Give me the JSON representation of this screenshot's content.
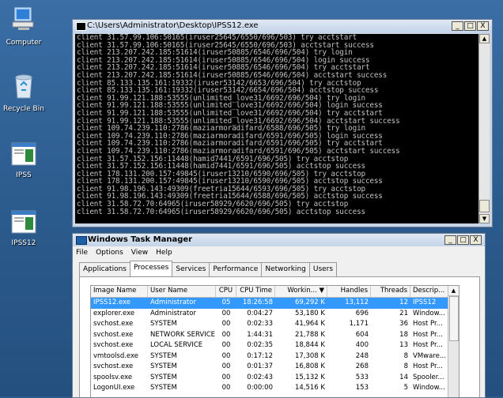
{
  "desktop": {
    "icons": [
      {
        "label": "Computer",
        "icon": "computer-icon"
      },
      {
        "label": "Recycle Bin",
        "icon": "recycle-bin-icon"
      },
      {
        "label": "IPSS",
        "icon": "program-icon"
      },
      {
        "label": "IPSS12",
        "icon": "program-icon"
      }
    ]
  },
  "cmd_window": {
    "title": "C:\\Users\\Administrator\\Desktop\\IPSS12.exe",
    "buttons": {
      "minimize": "_",
      "maximize": "□",
      "close": "X"
    },
    "lines": [
      "client 31.57.99.106:50165(iruser25645/6550/696/503) try acctstart",
      "client 31.57.99.106:50165(iruser25645/6550/696/503) acctstart success",
      "client 213.207.242.185:51614(iruser50885/6546/696/504) try login",
      "client 213.207.242.185:51614(iruser50885/6546/696/504) login success",
      "client 213.207.242.185:51614(iruser50885/6546/696/504) try acctstart",
      "client 213.207.242.185:51614(iruser50885/6546/696/504) acctstart success",
      "client 85.133.135.161:19332(iruser53142/6653/696/504) try acctstop",
      "client 85.133.135.161:19332(iruser53142/6654/696/504) acctstop success",
      "client 91.99.121.188:53555(unlimited_love31/6692/696/504) try login",
      "client 91.99.121.188:53555(unlimited_love31/6692/696/504) login success",
      "client 91.99.121.188:53555(unlimited_love31/6692/696/504) try acctstart",
      "client 91.99.121.188:53555(unlimited_love31/6692/696/504) acctstart success",
      "client 109.74.239.110:2786(maziarmoradifard/6588/696/505) try login",
      "client 109.74.239.110:2786(maziarmoradifard/6591/696/505) login success",
      "client 109.74.239.110:2786(maziarmoradifard/6591/696/505) try acctstart",
      "client 109.74.239.110:2786(maziarmoradifard/6591/696/505) acctstart success",
      "client 31.57.152.156:11448(hamid7441/6591/696/505) try acctstop",
      "client 31.57.152.156:11448(hamid7441/6591/696/505) acctstop success",
      "client 178.131.200.157:49845(iruser13210/6590/696/505) try acctstop",
      "client 178.131.200.157:49845(iruser13210/6590/696/505) acctstop success",
      "client 91.98.196.143:49309(freetria15644/6593/696/505) try acctstop",
      "client 91.98.196.143:49309(freetria15644/6588/696/505) acctstop success",
      "client 31.58.72.70:64965(iruser58929/6620/696/505) try acctstop",
      "client 31.58.72.70:64965(iruser58929/6620/696/505) acctstop success"
    ]
  },
  "task_manager": {
    "title": "Windows Task Manager",
    "menu": [
      "File",
      "Options",
      "View",
      "Help"
    ],
    "tabs": [
      "Applications",
      "Processes",
      "Services",
      "Performance",
      "Networking",
      "Users"
    ],
    "active_tab": "Processes",
    "columns": [
      "Image Name",
      "User Name",
      "CPU",
      "CPU Time",
      "Workin... ▼",
      "Handles",
      "Threads",
      "Descrip..."
    ],
    "rows": [
      [
        "IPSS12.exe",
        "Administrator",
        "05",
        "18:26:58",
        "69,292 K",
        "13,112",
        "12",
        "IPSS12"
      ],
      [
        "explorer.exe",
        "Administrator",
        "00",
        "0:04:27",
        "53,180 K",
        "696",
        "21",
        "Window..."
      ],
      [
        "svchost.exe",
        "SYSTEM",
        "00",
        "0:02:33",
        "41,964 K",
        "1,171",
        "36",
        "Host Pr..."
      ],
      [
        "svchost.exe",
        "NETWORK SERVICE",
        "00",
        "1:44:31",
        "21,788 K",
        "604",
        "18",
        "Host Pr..."
      ],
      [
        "svchost.exe",
        "LOCAL SERVICE",
        "00",
        "0:02:35",
        "18,844 K",
        "400",
        "13",
        "Host Pr..."
      ],
      [
        "vmtoolsd.exe",
        "SYSTEM",
        "00",
        "0:17:12",
        "17,308 K",
        "248",
        "8",
        "VMware..."
      ],
      [
        "svchost.exe",
        "SYSTEM",
        "00",
        "0:01:37",
        "16,808 K",
        "268",
        "8",
        "Host Pr..."
      ],
      [
        "spoolsv.exe",
        "SYSTEM",
        "00",
        "0:02:43",
        "15,132 K",
        "533",
        "14",
        "Spooler..."
      ],
      [
        "LogonUI.exe",
        "SYSTEM",
        "00",
        "0:00:00",
        "14,516 K",
        "153",
        "5",
        "Window..."
      ]
    ],
    "selected_row": 0
  }
}
